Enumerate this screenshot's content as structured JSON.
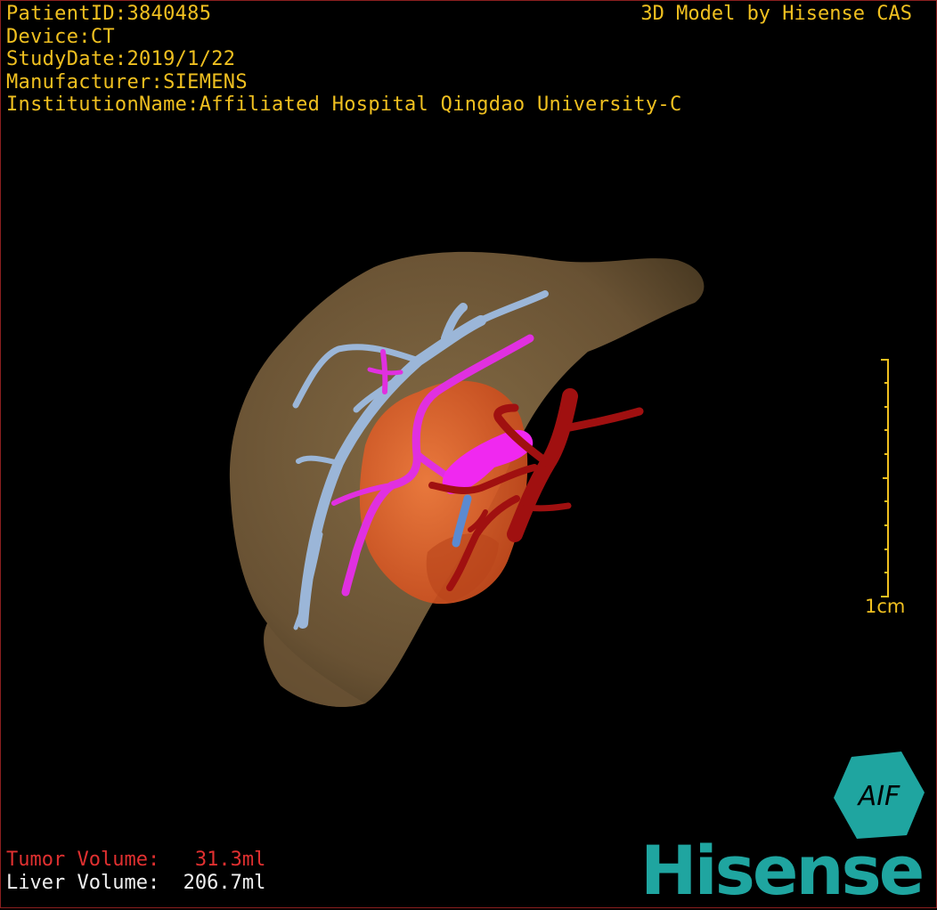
{
  "header": {
    "patient_id": "PatientID:3840485",
    "device": "Device:CT",
    "study_date": "StudyDate:2019/1/22",
    "manufacturer": "Manufacturer:SIEMENS",
    "institution": "InstitutionName:Affiliated Hospital Qingdao University-C"
  },
  "model_label": "3D Model by Hisense CAS",
  "scale_bar": {
    "label": "1cm"
  },
  "volumes": {
    "tumor": "Tumor Volume:   31.3ml",
    "liver": "Liver Volume:  206.7ml"
  },
  "brand": {
    "name": "Hisense",
    "logo_letters": "AIF"
  },
  "colors": {
    "overlay_text": "#f0c020",
    "tumor_text": "#e03030",
    "liver": "#7a6240",
    "tumor": "#e8622e",
    "portal_vein": "#9bb6d8",
    "hepatic_vein": "#e030e0",
    "artery": "#a01010",
    "brand": "#1fa5a0"
  }
}
